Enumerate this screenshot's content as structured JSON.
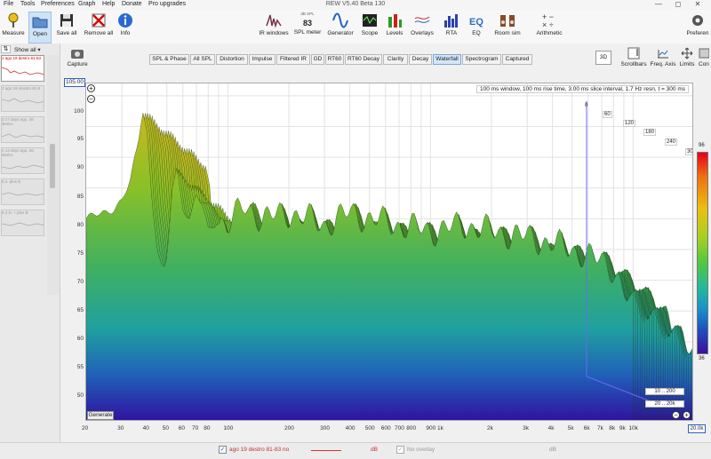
{
  "window": {
    "title": "REW V5.40 Beta 130"
  },
  "menu": [
    "File",
    "Tools",
    "Preferences",
    "Graph",
    "Help",
    "Donate",
    "Pro upgrades"
  ],
  "toolbar": {
    "left": [
      {
        "label": "Measure",
        "icon": "microphone-icon"
      },
      {
        "label": "Open",
        "icon": "folder-icon",
        "active": true
      },
      {
        "label": "Save all",
        "icon": "save-icon"
      },
      {
        "label": "Remove all",
        "icon": "remove-all-icon"
      },
      {
        "label": "Info",
        "icon": "info-icon"
      }
    ],
    "right": [
      {
        "label": "IR windows",
        "icon": "ir-windows-icon"
      },
      {
        "label": "SPL meter",
        "icon": "spl-meter-icon",
        "spl_unit": "dB SPL",
        "spl_value": "83"
      },
      {
        "label": "Generator",
        "icon": "generator-icon"
      },
      {
        "label": "Scope",
        "icon": "scope-icon"
      },
      {
        "label": "Levels",
        "icon": "levels-icon"
      },
      {
        "label": "Overlays",
        "icon": "overlays-icon"
      },
      {
        "label": "RTA",
        "icon": "rta-icon"
      },
      {
        "label": "EQ",
        "icon": "eq-icon"
      },
      {
        "label": "Room sim",
        "icon": "room-sim-icon"
      },
      {
        "label": "Arithmetic",
        "icon": "arithmetic-icon"
      }
    ],
    "far_right": {
      "label": "Preferen",
      "icon": "preferences-icon"
    }
  },
  "sidebar": {
    "show_all": "Show all",
    "capture_label": "Capture",
    "measurements": [
      "1 ago 19 destro 81-83",
      "2 ago 19 sinistro 81-8",
      "3 17 days ago, 36 destro",
      "4 14 days ago, 36 destro",
      "5 4. plus B",
      "6 4 D. + plus B"
    ]
  },
  "tabs": [
    "SPL & Phase",
    "All SPL",
    "Distortion",
    "Impulse",
    "Filtered IR",
    "GD",
    "RT60",
    "RT60 Decay",
    "Clarity",
    "Decay",
    "Waterfall",
    "Spectrogram",
    "Captured"
  ],
  "active_tab": "Waterfall",
  "right_controls": [
    {
      "label": "3D",
      "icon": "3d-toggle-icon"
    },
    {
      "label": "Scrollbars",
      "icon": "scrollbars-icon"
    },
    {
      "label": "Freq. Axis",
      "icon": "freq-axis-icon"
    },
    {
      "label": "Limits",
      "icon": "limits-icon"
    },
    {
      "label": "Con",
      "icon": "controls-icon"
    }
  ],
  "plot": {
    "info": "100 ms window, 100 ms rise time, 3.00 ms slice interval, 1.7 Hz resn, t = 300 ms",
    "top_value": "105.00",
    "y_ticks": [
      "100",
      "95",
      "90",
      "85",
      "80",
      "75",
      "70",
      "65",
      "60",
      "55",
      "50"
    ],
    "x_ticks": [
      "20",
      "30",
      "40",
      "50",
      "60",
      "70",
      "80",
      "100",
      "200",
      "300",
      "400",
      "500",
      "600",
      "700",
      "800",
      "900 1k",
      "2k",
      "3k",
      "4k",
      "5k",
      "6k",
      "7k",
      "8k",
      "9k",
      "10k"
    ],
    "x_right": "20.0k",
    "time_ticks": [
      "0",
      "60",
      "120",
      "180",
      "240",
      "300"
    ],
    "range_a": "10 .. 200",
    "range_b": "20 .. 20k",
    "colorbar_top": "96",
    "colorbar_bottom": "36",
    "generate_label": "Generate"
  },
  "chart_data": {
    "type": "area",
    "title": "",
    "xlabel": "",
    "ylabel": "",
    "x_scale": "log",
    "xlim": [
      20,
      20000
    ],
    "ylim": [
      47,
      102
    ],
    "series": [
      {
        "x": [
          20,
          22,
          25,
          28,
          30,
          33,
          36,
          38,
          40,
          42,
          45,
          48,
          50,
          53,
          56,
          60,
          65,
          70,
          75,
          80,
          90,
          100,
          120,
          150,
          200,
          250,
          300,
          400,
          500,
          700,
          1000,
          1500,
          2000,
          3000,
          4000,
          5000,
          6000,
          8000,
          10000
        ],
        "values": [
          80,
          80.5,
          81,
          82,
          83,
          86,
          92,
          98,
          94,
          84,
          75,
          71,
          73,
          85,
          88,
          82,
          80,
          84,
          82,
          78,
          80,
          79,
          82,
          80,
          81,
          80,
          79,
          81,
          80,
          79,
          78,
          79,
          78,
          77,
          76,
          75,
          74,
          72,
          65
        ]
      }
    ]
  },
  "status": {
    "measurement": "ago 19 destro 81-83 no",
    "unit": "dB",
    "overlay": "No overlay",
    "overlay_unit": "dB"
  }
}
